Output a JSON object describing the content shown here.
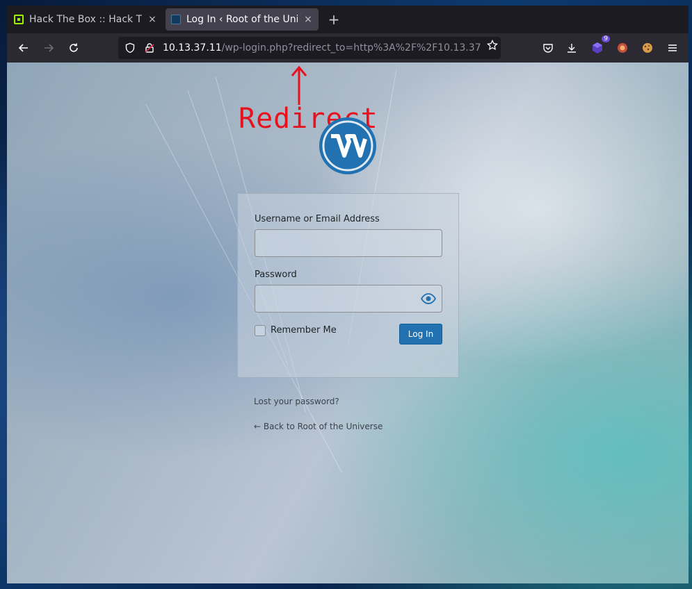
{
  "browser": {
    "tabs": [
      {
        "title": "Hack The Box :: Hack The",
        "close": "×",
        "active": false
      },
      {
        "title": "Log In ‹ Root of the Unive",
        "close": "×",
        "active": true
      }
    ],
    "new_tab": "+",
    "url": {
      "host": "10.13.37.11",
      "path": "/wp-login.php?redirect_to=http%3A%2F%2F10.13.37"
    },
    "extension_badge": "9"
  },
  "annotation": {
    "text": "Redirect",
    "color": "#e8121f"
  },
  "login": {
    "username_label": "Username or Email Address",
    "password_label": "Password",
    "remember_label": "Remember Me",
    "submit_label": "Log In",
    "lost_password": "Lost your password?",
    "back_link": "← Back to Root of the Universe"
  },
  "colors": {
    "wp_blue": "#2271b1",
    "tab_bg": "#1c1b22",
    "toolbar_bg": "#2b2a33"
  }
}
